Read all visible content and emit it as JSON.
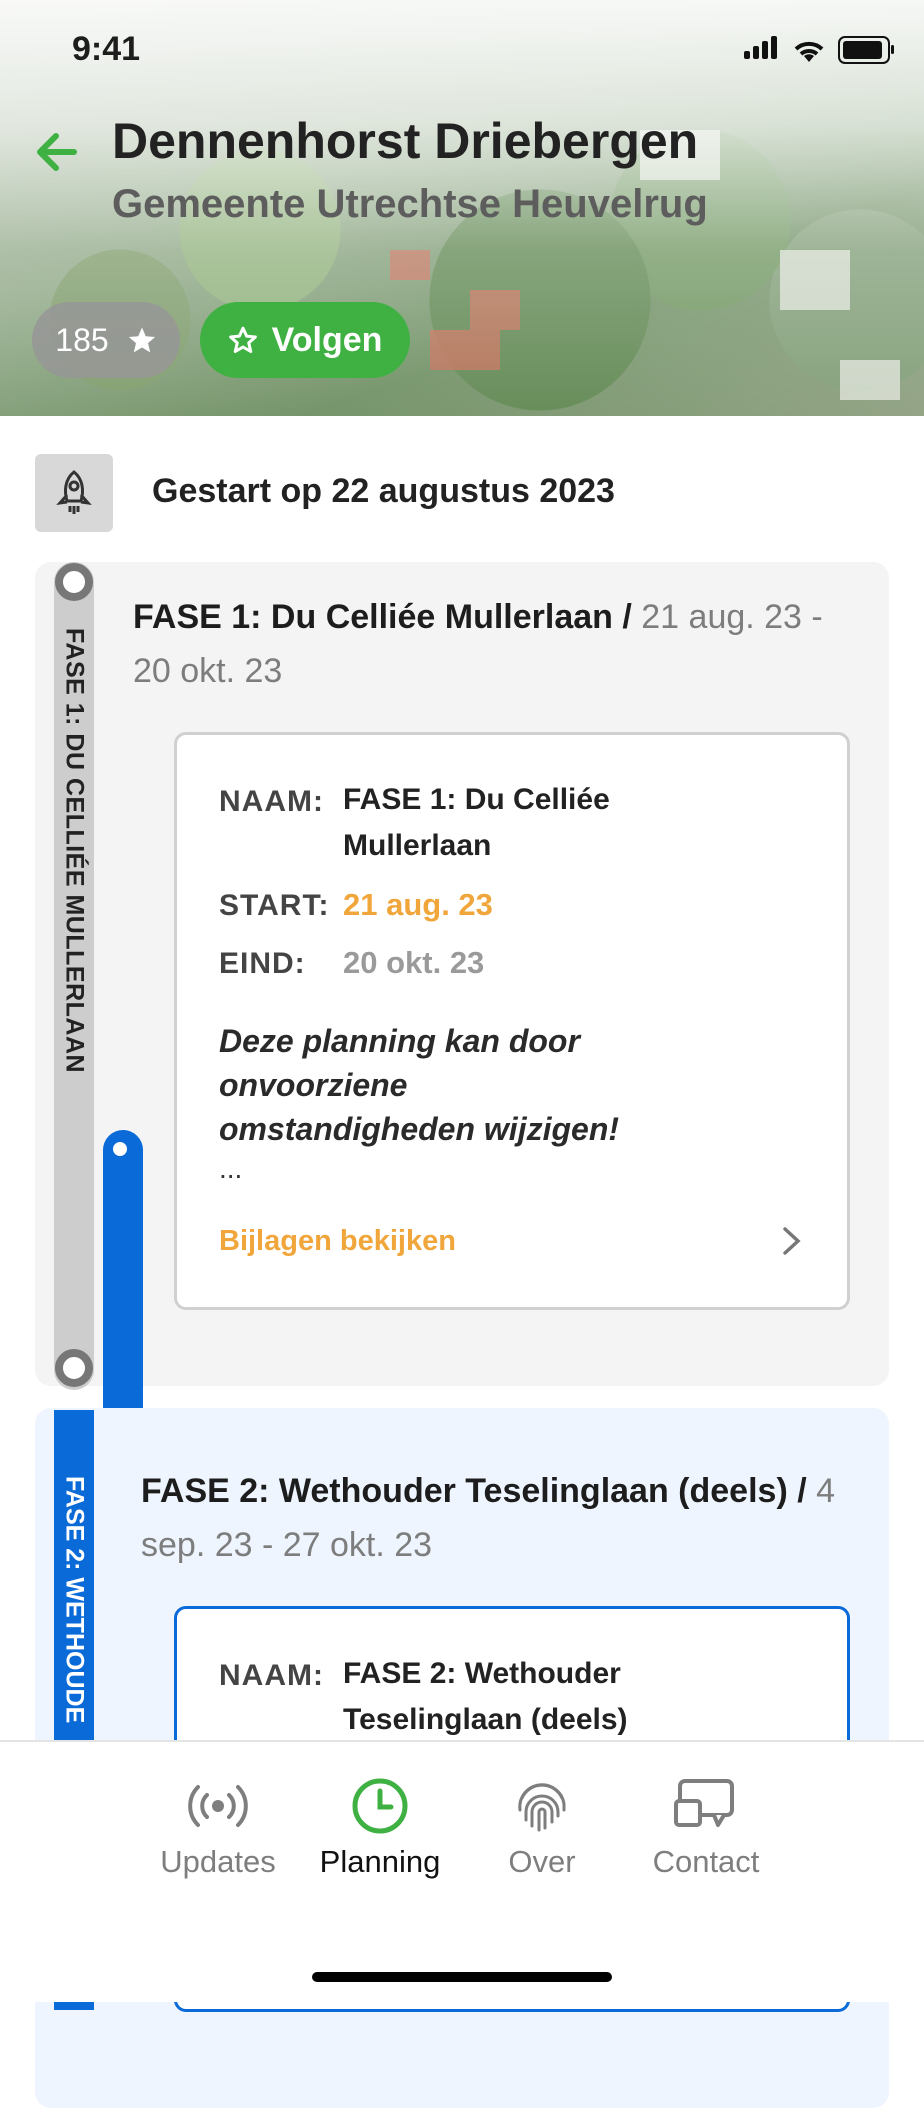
{
  "status": {
    "time": "9:41"
  },
  "header": {
    "title": "Dennenhorst Driebergen",
    "subtitle": "Gemeente Utrechtse Heuvelrug",
    "follow_count": "185",
    "follow_label": "Volgen"
  },
  "started": {
    "text": "Gestart op 22 augustus 2023"
  },
  "phases": [
    {
      "vertical_label": "FASE 1: DU CELLIÉE MULLERLAAN",
      "title": "FASE 1: Du Celliée Mullerlaan /",
      "dates": "21 aug. 23 - 20 okt. 23",
      "naam_label": "NAAM:",
      "naam_value": "FASE 1: Du Celliée Mullerlaan",
      "start_label": "START:",
      "start_value": "21 aug. 23",
      "eind_label": "EIND:",
      "eind_value": "20 okt. 23",
      "note": "Deze planning kan door onvoorziene omstandigheden wijzigen!",
      "ellipsis": "...",
      "attachments": "Bijlagen bekijken"
    },
    {
      "vertical_label": "FASE 2: WETHOUDE",
      "title": "FASE 2: Wethouder Teselinglaan (deels) /",
      "dates": "4 sep. 23 - 27 okt. 23",
      "naam_label": "NAAM:",
      "naam_value": "FASE 2: Wethouder Teselinglaan (deels)"
    }
  ],
  "tabs": [
    {
      "label": "Updates",
      "icon": "broadcast-icon"
    },
    {
      "label": "Planning",
      "icon": "clock-icon",
      "active": true
    },
    {
      "label": "Over",
      "icon": "fingerprint-icon"
    },
    {
      "label": "Contact",
      "icon": "chat-icon"
    }
  ],
  "colors": {
    "green": "#3fb143",
    "blue": "#0a6ad8",
    "orange": "#f0a63b"
  }
}
